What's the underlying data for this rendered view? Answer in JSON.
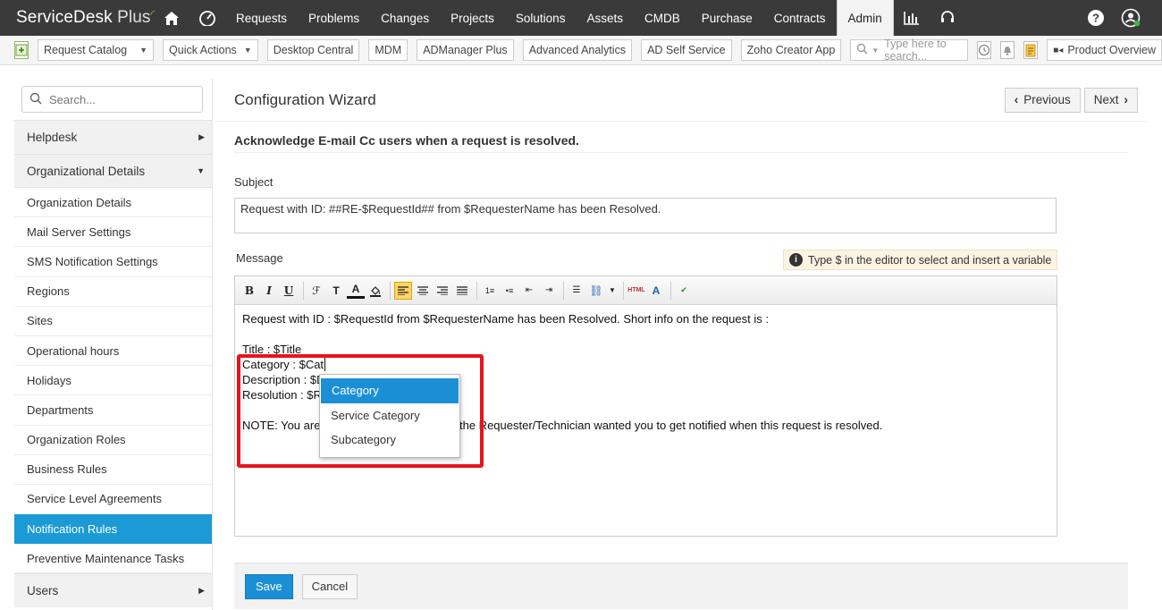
{
  "app": {
    "name": "ServiceDesk",
    "name_plus": "Plus"
  },
  "topnav": {
    "items": [
      {
        "label": "Requests"
      },
      {
        "label": "Problems"
      },
      {
        "label": "Changes"
      },
      {
        "label": "Projects"
      },
      {
        "label": "Solutions"
      },
      {
        "label": "Assets"
      },
      {
        "label": "CMDB"
      },
      {
        "label": "Purchase"
      },
      {
        "label": "Contracts"
      },
      {
        "label": "Admin"
      }
    ],
    "active": "Admin"
  },
  "toolbar": {
    "request_catalog": "Request Catalog",
    "quick_actions": "Quick Actions",
    "links": [
      "Desktop Central",
      "MDM",
      "ADManager Plus",
      "Advanced Analytics",
      "AD Self Service",
      "Zoho Creator App"
    ],
    "search_placeholder": "Type here to search...",
    "product_overview": "Product Overview"
  },
  "sidebar": {
    "search_placeholder": "Search...",
    "groups": {
      "helpdesk": "Helpdesk",
      "org_details": "Organizational Details",
      "users": "Users"
    },
    "items": [
      {
        "label": "Organization Details"
      },
      {
        "label": "Mail Server Settings"
      },
      {
        "label": "SMS Notification Settings"
      },
      {
        "label": "Regions"
      },
      {
        "label": "Sites"
      },
      {
        "label": "Operational hours"
      },
      {
        "label": "Holidays"
      },
      {
        "label": "Departments"
      },
      {
        "label": "Organization Roles"
      },
      {
        "label": "Business Rules"
      },
      {
        "label": "Service Level Agreements"
      },
      {
        "label": "Notification Rules"
      },
      {
        "label": "Preventive Maintenance Tasks"
      }
    ],
    "active": "Notification Rules"
  },
  "main": {
    "title": "Configuration Wizard",
    "previous": "Previous",
    "next": "Next",
    "subtitle": "Acknowledge E-mail Cc users when a request is resolved.",
    "subject_label": "Subject",
    "subject_value": "Request with ID: ##RE-$RequestId## from $RequesterName has been Resolved.",
    "message_label": "Message",
    "hint": "Type $ in the editor to select and insert a variable",
    "message_lines": {
      "l1": "Request with ID : $RequestId from $RequesterName has been Resolved. Short info on the request is :",
      "l3": "Title : $Title",
      "l4": "Category : $Cat",
      "l5": "Description : $D",
      "l6": "Resolution : $Re",
      "l8a": "NOTE: You are r",
      "l8b": "the Requester/Technician wanted you to get notified when this request is resolved."
    },
    "variable_dropdown": [
      "Category",
      "Service Category",
      "Subcategory"
    ],
    "variable_selected": "Category",
    "save": "Save",
    "cancel": "Cancel"
  },
  "colors": {
    "topbar": "#3a3a3a",
    "accent": "#1b8fd6",
    "highlight": "#e8141c",
    "hint_bg": "#fdf3e3"
  }
}
